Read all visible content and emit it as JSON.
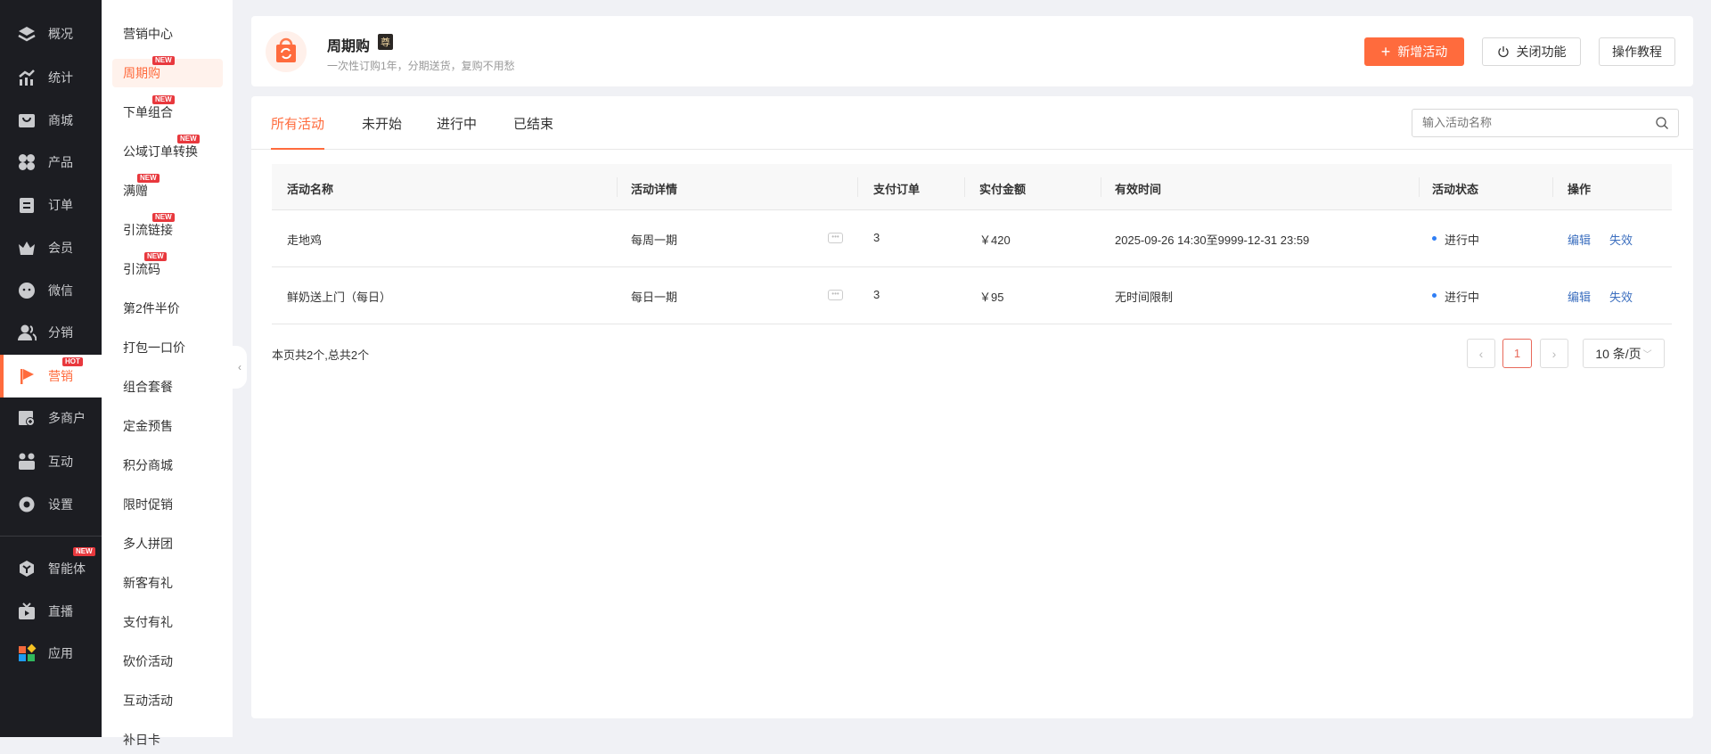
{
  "nav": {
    "items": [
      {
        "label": "概况",
        "icon": "layers-icon"
      },
      {
        "label": "统计",
        "icon": "stats-icon"
      },
      {
        "label": "商城",
        "icon": "shop-icon"
      },
      {
        "label": "产品",
        "icon": "product-icon"
      },
      {
        "label": "订单",
        "icon": "order-icon"
      },
      {
        "label": "会员",
        "icon": "crown-icon"
      },
      {
        "label": "微信",
        "icon": "wechat-icon"
      },
      {
        "label": "分销",
        "icon": "users-icon"
      },
      {
        "label": "营销",
        "icon": "flag-icon",
        "badge": "HOT",
        "active": true
      },
      {
        "label": "多商户",
        "icon": "store-add-icon"
      },
      {
        "label": "互动",
        "icon": "interact-icon"
      },
      {
        "label": "设置",
        "icon": "gear-icon"
      },
      {
        "label": "智能体",
        "icon": "agent-icon",
        "badge": "NEW"
      },
      {
        "label": "直播",
        "icon": "tv-icon"
      },
      {
        "label": "应用",
        "icon": "apps-icon"
      }
    ]
  },
  "subnav": {
    "items": [
      {
        "label": "营销中心"
      },
      {
        "label": "周期购",
        "badge": "NEW",
        "active": true
      },
      {
        "label": "下单组合",
        "badge": "NEW"
      },
      {
        "label": "公域订单转换",
        "badge": "NEW"
      },
      {
        "label": "满赠",
        "badge": "NEW"
      },
      {
        "label": "引流链接",
        "badge": "NEW"
      },
      {
        "label": "引流码",
        "badge": "NEW"
      },
      {
        "label": "第2件半价"
      },
      {
        "label": "打包一口价"
      },
      {
        "label": "组合套餐"
      },
      {
        "label": "定金预售"
      },
      {
        "label": "积分商城"
      },
      {
        "label": "限时促销"
      },
      {
        "label": "多人拼团"
      },
      {
        "label": "新客有礼"
      },
      {
        "label": "支付有礼"
      },
      {
        "label": "砍价活动"
      },
      {
        "label": "互动活动"
      },
      {
        "label": "补日卡"
      }
    ]
  },
  "header": {
    "title": "周期购",
    "tag": "尊",
    "subtitle": "一次性订购1年，分期送货，复购不用愁",
    "add_label": "新增活动",
    "close_label": "关闭功能",
    "tutorial_label": "操作教程"
  },
  "tabs": [
    "所有活动",
    "未开始",
    "进行中",
    "已结束"
  ],
  "search": {
    "placeholder": "输入活动名称"
  },
  "table": {
    "columns": [
      "活动名称",
      "活动详情",
      "支付订单",
      "实付金额",
      "有效时间",
      "活动状态",
      "操作"
    ],
    "rows": [
      {
        "name": "走地鸡",
        "detail": "每周一期",
        "orders": "3",
        "amount": "￥420",
        "time": "2025-09-26 14:30至9999-12-31 23:59",
        "status": "进行中",
        "edit": "编辑",
        "disable": "失效"
      },
      {
        "name": "鲜奶送上门（每日）",
        "detail": "每日一期",
        "orders": "3",
        "amount": "￥95",
        "time": "无时间限制",
        "status": "进行中",
        "edit": "编辑",
        "disable": "失效"
      }
    ]
  },
  "footer": {
    "summary": "本页共2个,总共2个",
    "current_page": "1",
    "page_size": "10 条/页"
  },
  "colors": {
    "accent": "#ff6b3d",
    "link": "#3c6fbf",
    "status_dot": "#2f7ef5",
    "sidebar": "#1c1d22"
  }
}
